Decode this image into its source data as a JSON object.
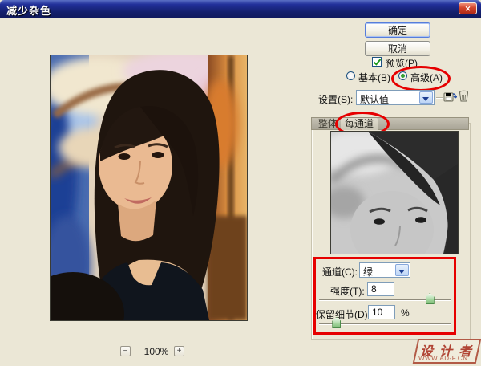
{
  "window": {
    "title": "减少杂色",
    "close_glyph": "✕"
  },
  "actions": {
    "ok": "确定",
    "cancel": "取消"
  },
  "preview": {
    "label": "预览(P)",
    "checked": true
  },
  "mode": {
    "basic": "基本(B)",
    "advanced": "高级(A)",
    "selected": "advanced"
  },
  "settings": {
    "label": "设置(S):",
    "value": "默认值"
  },
  "tabs": {
    "overall": "整体",
    "per_channel": "每通道",
    "active": "per_channel"
  },
  "channel": {
    "label": "通道(C):",
    "value": "绿"
  },
  "strength": {
    "label": "强度(T):",
    "value": "8",
    "slider_pct": 84
  },
  "preserve": {
    "label": "保留细节(D):",
    "value": "10",
    "unit": "%",
    "slider_pct": 13
  },
  "zoom_bar": {
    "minus": "−",
    "level": "100%",
    "plus": "+"
  },
  "watermark": {
    "name": "设计者",
    "site": "WWW.AD-F.CN"
  },
  "colors": {
    "annotation": "#e60000",
    "titlebar": "#131f6b",
    "dialog_bg": "#ebe7d6",
    "slider_thumb": "#a6d7a0",
    "close_button": "#d2452c"
  },
  "icons": {
    "save": "save-settings-icon",
    "trash": "delete-settings-icon",
    "dropdown": "chevron-down-icon"
  }
}
